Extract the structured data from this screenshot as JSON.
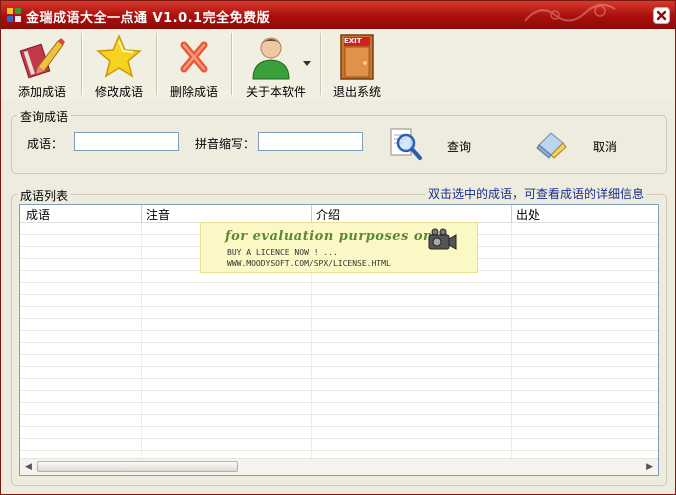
{
  "window": {
    "title": "金瑞成语大全一点通 V1.0.1完全免费版"
  },
  "toolbar": {
    "buttons": [
      {
        "label": "添加成语",
        "icon": "add-idiom-icon"
      },
      {
        "label": "修改成语",
        "icon": "star-icon"
      },
      {
        "label": "删除成语",
        "icon": "delete-x-icon"
      },
      {
        "label": "关于本软件",
        "icon": "user-icon",
        "has_dropdown": true
      },
      {
        "label": "退出系统",
        "icon": "exit-door-icon",
        "icon_text": "EXIT"
      }
    ]
  },
  "query": {
    "group_label": "查询成语",
    "idiom_label": "成语：",
    "idiom_value": "",
    "pinyin_label": "拼音缩写：",
    "pinyin_value": "",
    "search_label": "查询",
    "cancel_label": "取消"
  },
  "list": {
    "group_label": "成语列表",
    "hint": "双击选中的成语，可查看成语的详细信息",
    "columns": [
      "成语",
      "注音",
      "介绍",
      "出处"
    ],
    "rows": []
  },
  "watermark": {
    "line1": "for evaluation purposes only.",
    "line2": "BUY A LICENCE NOW ! ...",
    "line3": "WWW.MOODYSOFT.COM/SPX/LICENSE.HTML"
  },
  "colors": {
    "titlebar": "#a80f0c",
    "hint_text": "#1a2d8c",
    "watermark_bg": "#fbf8c6"
  }
}
